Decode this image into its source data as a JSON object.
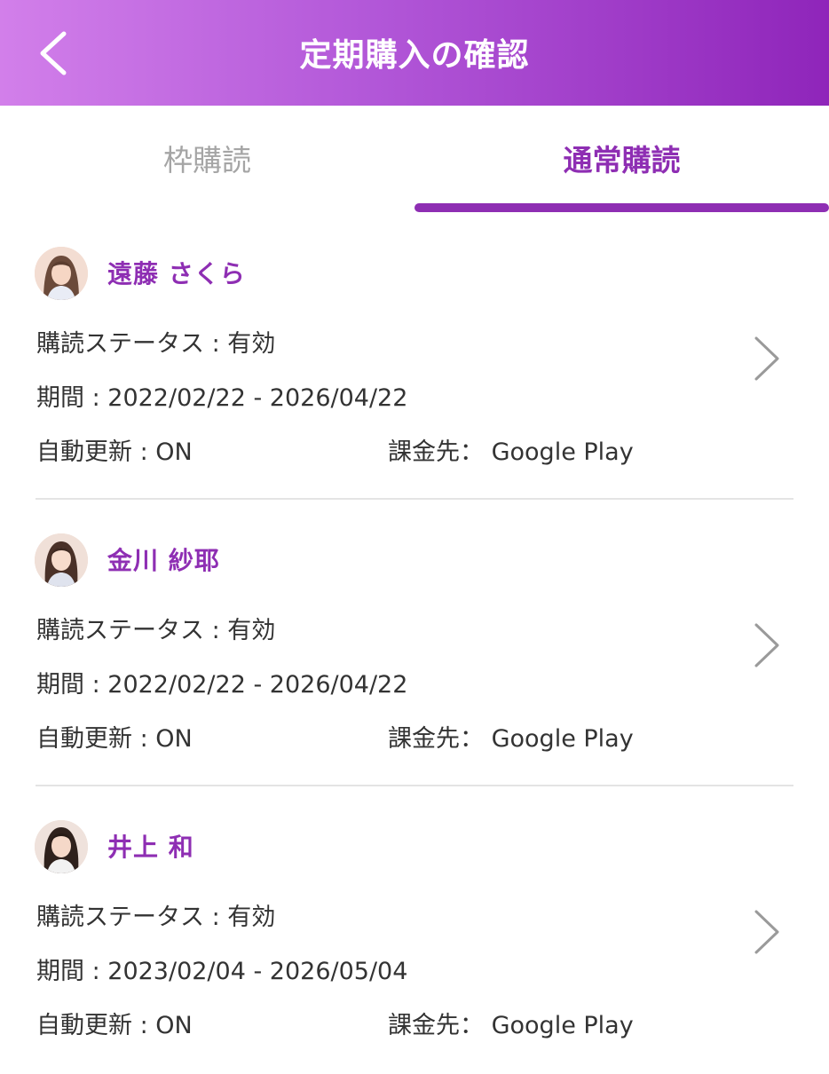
{
  "header": {
    "title": "定期購入の確認",
    "back_icon": "chevron-left-icon"
  },
  "tabs": [
    {
      "label": "枠購読",
      "active": false
    },
    {
      "label": "通常購読",
      "active": true
    }
  ],
  "colors": {
    "accent": "#8e2eb3",
    "header_gradient_start": "#d27fea",
    "header_gradient_end": "#8f25ba"
  },
  "subscriptions": [
    {
      "name": "遠藤 さくら",
      "status_label": "購読ステータス",
      "status_value": "有効",
      "period_label": "期間",
      "period_value": "2022/02/22 - 2026/04/22",
      "auto_renew_label": "自動更新",
      "auto_renew_value": "ON",
      "billing_label": "課金先：",
      "billing_value": "Google Play"
    },
    {
      "name": "金川 紗耶",
      "status_label": "購読ステータス",
      "status_value": "有効",
      "period_label": "期間",
      "period_value": "2022/02/22 - 2026/04/22",
      "auto_renew_label": "自動更新",
      "auto_renew_value": "ON",
      "billing_label": "課金先：",
      "billing_value": "Google Play"
    },
    {
      "name": "井上 和",
      "status_label": "購読ステータス",
      "status_value": "有効",
      "period_label": "期間",
      "period_value": "2023/02/04 - 2026/05/04",
      "auto_renew_label": "自動更新",
      "auto_renew_value": "ON",
      "billing_label": "課金先：",
      "billing_value": "Google Play"
    }
  ]
}
